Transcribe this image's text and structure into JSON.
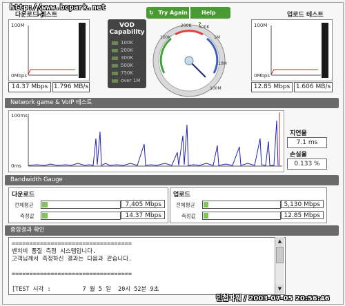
{
  "watermark": "http://www.bcpark.net",
  "download": {
    "title": "다운로드 테스트",
    "scale_top": "100M",
    "scale_bottom": "0Mbps",
    "mbps": "14.37 Mbps",
    "mbytes": "1.796 MB/s"
  },
  "upload": {
    "title": "업로드 테스트",
    "scale_top": "100M",
    "scale_bottom": "0Mbps",
    "mbps": "12.85 Mbps",
    "mbytes": "1.606 MB/s"
  },
  "vod": {
    "title_1": "VOD",
    "title_2": "Capability",
    "levels": [
      "100K",
      "200K",
      "300K",
      "500K",
      "750K",
      "over 1M"
    ]
  },
  "controls": {
    "try_again": "Try Again",
    "help": "Help",
    "help_icon": "question-icon",
    "try_again_icon": "refresh-icon"
  },
  "speedometer": {
    "ticks": [
      "100K",
      "200K",
      "500K",
      "1M",
      "10M",
      "100M"
    ],
    "value_mbps": 14.37
  },
  "network": {
    "section_title": "Network game & VoIP 테스트",
    "scale_top": "100ms",
    "scale_bottom": "0ms",
    "latency_label": "지연율",
    "latency_value": "7.1 ms",
    "loss_label": "손실율",
    "loss_value": "0.133 %"
  },
  "bandwidth": {
    "section_title": "Bandwidth Gauge",
    "download": {
      "title": "다운로드",
      "avg_label": "전체평균",
      "avg_value": "7,405 Mbps",
      "avg_fraction": 0.07,
      "measured_label": "측정값",
      "measured_value": "14.37 Mbps",
      "measured_fraction": 0.07
    },
    "upload": {
      "title": "업로드",
      "avg_label": "전체평균",
      "avg_value": "5,130 Mbps",
      "avg_fraction": 0.06,
      "measured_label": "측정값",
      "measured_value": "12.85 Mbps",
      "measured_fraction": 0.06
    }
  },
  "result": {
    "section_title": "종합결과 확인",
    "lines": [
      "==================================",
      "벤치비 품질 측정 시스템입니다.",
      "고객님께서 측정하신 결과는 다음과 같습니다.",
      "",
      "==================================",
      "",
      "[TEST 시각 :         7 월 5 일  20시 52분 9초"
    ]
  },
  "footer": "민첩파워 / 2003-07-05 20:56:46",
  "colors": {
    "accent_green": "#4a9a34",
    "dark_bar": "#1a1a1a",
    "graph_red": "#d02020",
    "graph_blue": "#2020b0",
    "gauge_fill": "#7fc55a"
  }
}
